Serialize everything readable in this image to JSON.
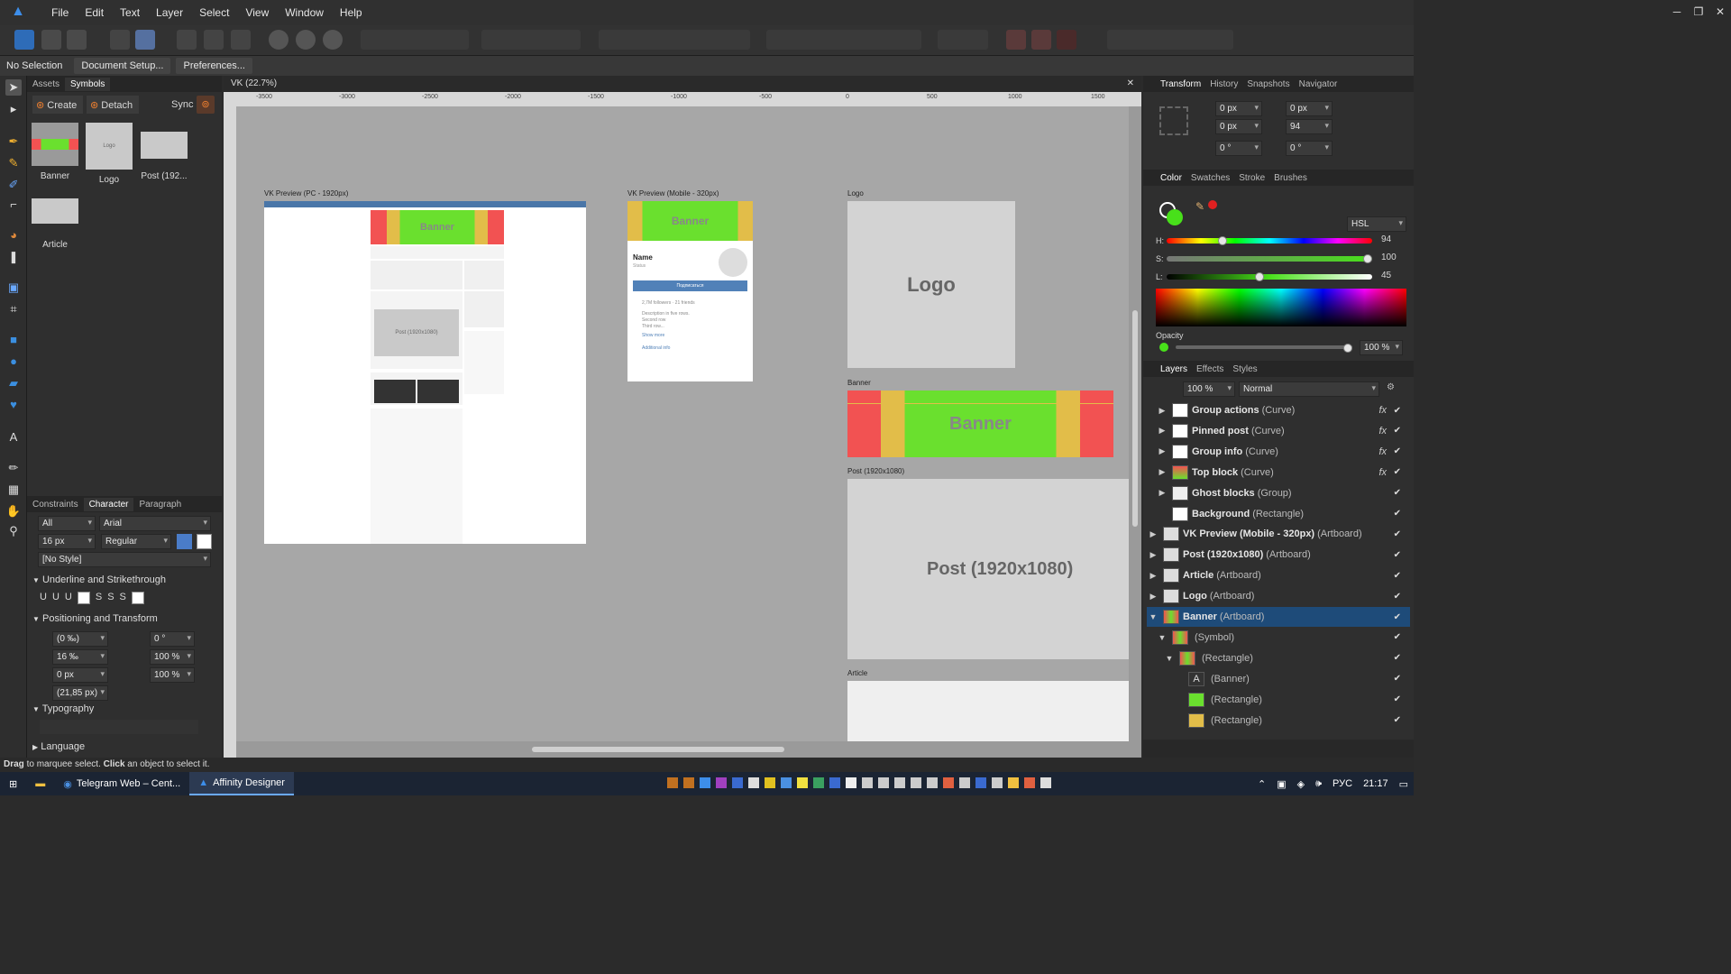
{
  "app": {
    "logo_icon": "affinity-designer-icon",
    "menu": [
      "File",
      "Edit",
      "Text",
      "Layer",
      "Select",
      "View",
      "Window",
      "Help"
    ]
  },
  "context": {
    "selection": "No Selection",
    "doc_setup": "Document Setup...",
    "prefs": "Preferences..."
  },
  "left": {
    "tabs": [
      "Assets",
      "Symbols"
    ],
    "create": "Create",
    "detach": "Detach",
    "sync": "Sync",
    "symbols": [
      "Banner",
      "Logo",
      "Post (192...",
      "Article"
    ],
    "char_tabs": [
      "Constraints",
      "Character",
      "Paragraph"
    ],
    "scope": "All",
    "font": "Arial",
    "size": "16 px",
    "weight": "Regular",
    "style": "[No Style]",
    "underline_section": "Underline and Strikethrough",
    "pos_section": "Positioning and Transform",
    "kern": "(0 ‰)",
    "rot": "0 °",
    "track": "16 ‰",
    "scale_h": "100 %",
    "baseline": "0 px",
    "scale_v": "100 %",
    "leading": "(21,85 px)",
    "typography": "Typography",
    "language": "Language"
  },
  "doc": {
    "tab": "VK (22.7%)",
    "ruler_h": [
      "-3500",
      "-3000",
      "-2500",
      "-2000",
      "-1500",
      "-1000",
      "-500",
      "0",
      "500",
      "1000",
      "1500"
    ],
    "artboards": {
      "pc": "VK Preview (PC - 1920px)",
      "mobile": "VK Preview (Mobile - 320px)",
      "logo": "Logo",
      "banner": "Banner",
      "post": "Post (1920x1080)",
      "article": "Article"
    },
    "banner_text": "Banner",
    "logo_text": "Logo",
    "post_text": "Post (1920x1080)",
    "pc_post_text": "Post (1920x1080)",
    "mobile": {
      "name": "Name",
      "status": "Status",
      "button": "Подписаться",
      "followers": "2,7M followers · 21 friends",
      "desc": "Description in five rows.",
      "row2": "Second row",
      "row3": "Third row...",
      "more": "Show more",
      "info": "Additional info"
    }
  },
  "right": {
    "top_tabs": [
      "Transform",
      "History",
      "Snapshots",
      "Navigator"
    ],
    "x": "0 px",
    "y": "0 px",
    "w": "0 px",
    "h": "94",
    "r": "0 °",
    "s": "0 °",
    "color_tabs": [
      "Color",
      "Swatches",
      "Stroke",
      "Brushes"
    ],
    "model": "HSL",
    "s_val": "100",
    "l": "45",
    "opacity_label": "Opacity",
    "opacity": "100 %",
    "layer_tabs": [
      "Layers",
      "Effects",
      "Styles"
    ],
    "layer_opacity": "100 %",
    "blend": "Normal",
    "layers": [
      {
        "name": "Group actions",
        "type": "(Curve)"
      },
      {
        "name": "Pinned post",
        "type": "(Curve)"
      },
      {
        "name": "Group info",
        "type": "(Curve)"
      },
      {
        "name": "Top block",
        "type": "(Curve)"
      },
      {
        "name": "Ghost blocks",
        "type": "(Group)"
      },
      {
        "name": "Background",
        "type": "(Rectangle)"
      },
      {
        "name": "VK Preview (Mobile - 320px)",
        "type": "(Artboard)"
      },
      {
        "name": "Post (1920x1080)",
        "type": "(Artboard)"
      },
      {
        "name": "Article",
        "type": "(Artboard)"
      },
      {
        "name": "Logo",
        "type": "(Artboard)"
      },
      {
        "name": "Banner",
        "type": "(Artboard)"
      },
      {
        "name": "",
        "type": "(Symbol)"
      },
      {
        "name": "",
        "type": "(Rectangle)"
      },
      {
        "name": "",
        "type": "(Banner)"
      },
      {
        "name": "",
        "type": "(Rectangle)"
      },
      {
        "name": "",
        "type": "(Rectangle)"
      }
    ]
  },
  "status": {
    "drag": "Drag",
    "t1": " to marquee select. ",
    "click": "Click",
    "t2": " an object to select it."
  },
  "taskbar": {
    "tasks": [
      "Telegram Web – Cent...",
      "Affinity Designer"
    ],
    "lang": "РУС",
    "time": "21:17"
  },
  "colors": {
    "accent": "#3d8eea",
    "green": "#6ae02e",
    "banner_red": "#f25252",
    "banner_yellow": "#e2bd49",
    "selection": "#1e4b79"
  }
}
